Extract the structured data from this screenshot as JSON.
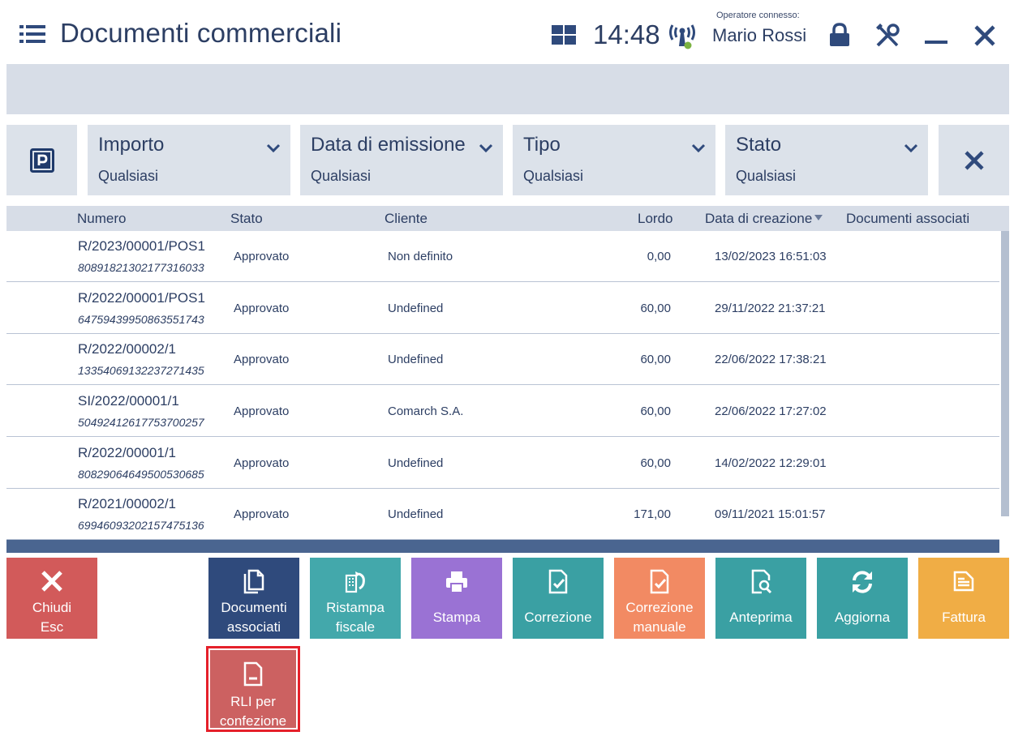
{
  "header": {
    "title": "Documenti commerciali",
    "clock": "14:48",
    "operator_label": "Operatore connesso:",
    "operator_name": "Mario Rossi"
  },
  "filters": [
    {
      "label": "Importo",
      "value": "Qualsiasi"
    },
    {
      "label": "Data di emissione",
      "value": "Qualsiasi"
    },
    {
      "label": "Tipo",
      "value": "Qualsiasi"
    },
    {
      "label": "Stato",
      "value": "Qualsiasi"
    }
  ],
  "table": {
    "columns": [
      "Numero",
      "Stato",
      "Cliente",
      "Lordo",
      "Data di creazione",
      "Documenti associati"
    ],
    "sort_column": "Data di creazione",
    "sort_direction": "desc",
    "rows": [
      {
        "numero": "R/2023/00001/POS1",
        "id": "80891821302177316033",
        "stato": "Approvato",
        "cliente": "Non definito",
        "lordo": "0,00",
        "data": "13/02/2023 16:51:03",
        "associati": ""
      },
      {
        "numero": "R/2022/00001/POS1",
        "id": "64759439950863551743",
        "stato": "Approvato",
        "cliente": "Undefined",
        "lordo": "60,00",
        "data": "29/11/2022 21:37:21",
        "associati": ""
      },
      {
        "numero": "R/2022/00002/1",
        "id": "13354069132237271435",
        "stato": "Approvato",
        "cliente": "Undefined",
        "lordo": "60,00",
        "data": "22/06/2022 17:38:21",
        "associati": ""
      },
      {
        "numero": "SI/2022/00001/1",
        "id": "50492412617753700257",
        "stato": "Approvato",
        "cliente": "Comarch S.A.",
        "lordo": "60,00",
        "data": "22/06/2022 17:27:02",
        "associati": ""
      },
      {
        "numero": "R/2022/00001/1",
        "id": "80829064649500530685",
        "stato": "Approvato",
        "cliente": "Undefined",
        "lordo": "60,00",
        "data": "14/02/2022 12:29:01",
        "associati": ""
      },
      {
        "numero": "R/2021/00002/1",
        "id": "69946093202157475136",
        "stato": "Approvato",
        "cliente": "Undefined",
        "lordo": "171,00",
        "data": "09/11/2021 15:01:57",
        "associati": ""
      }
    ]
  },
  "actions": [
    {
      "line1": "Chiudi",
      "line2": "Esc",
      "color": "#d25a5a",
      "icon": "close-icon"
    },
    {
      "line1": "Documenti",
      "line2": "associati",
      "color": "#2f4a7c",
      "icon": "copy-documents-icon"
    },
    {
      "line1": "Ristampa",
      "line2": "fiscale",
      "color": "#43a8ab",
      "icon": "reprint-fiscal-icon"
    },
    {
      "line1": "Stampa",
      "line2": "",
      "color": "#9a72d4",
      "icon": "printer-icon"
    },
    {
      "line1": "Correzione",
      "line2": "",
      "color": "#3aa0a3",
      "icon": "document-check-icon"
    },
    {
      "line1": "Correzione",
      "line2": "manuale",
      "color": "#f28a63",
      "icon": "document-edit-icon"
    },
    {
      "line1": "Anteprima",
      "line2": "",
      "color": "#3aa0a3",
      "icon": "document-search-icon"
    },
    {
      "line1": "Aggiorna",
      "line2": "",
      "color": "#3aa0a3",
      "icon": "refresh-icon"
    },
    {
      "line1": "Fattura",
      "line2": "",
      "color": "#f0ad45",
      "icon": "invoice-icon"
    }
  ],
  "extra_action": {
    "line1": "RLI per",
    "line2": "confezione",
    "color": "#cc6161",
    "highlight": "#e5202a",
    "icon": "document-icon"
  }
}
